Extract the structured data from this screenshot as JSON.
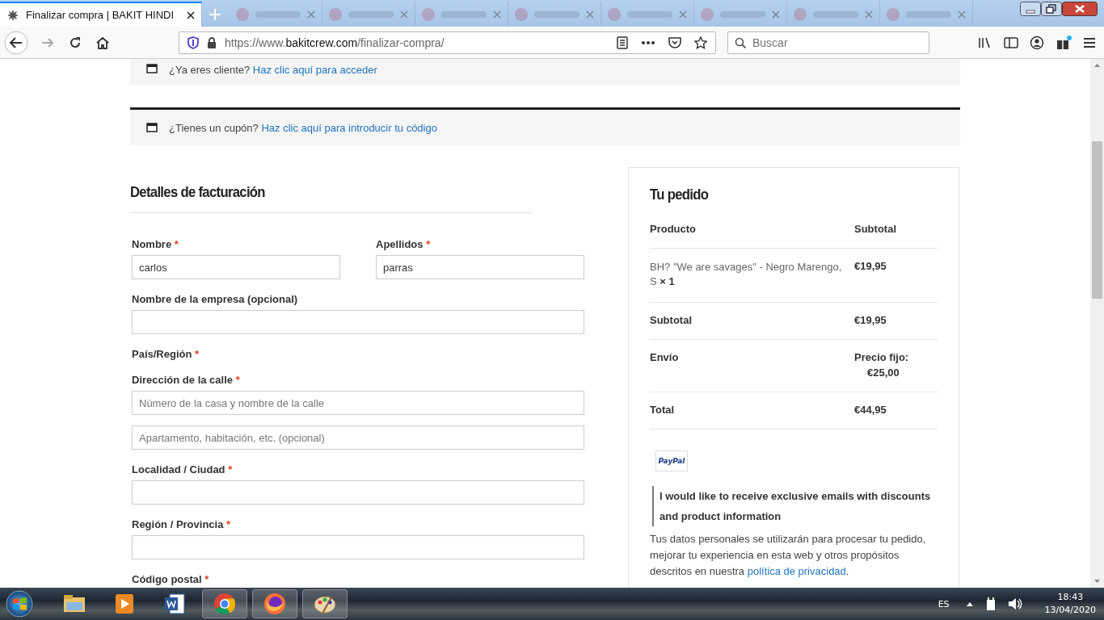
{
  "browser": {
    "tabs": [
      {
        "title": "Finalizar compra | BAKIT HINDI",
        "selected": true
      },
      {
        "selected": false
      },
      {
        "selected": false
      },
      {
        "selected": false
      },
      {
        "selected": false
      },
      {
        "selected": false
      },
      {
        "selected": false
      },
      {
        "selected": false
      },
      {
        "selected": false
      }
    ],
    "url": {
      "host_before": "https://www.",
      "host": "bakitcrew.com",
      "path": "/finalizar-compra/"
    },
    "search": {
      "placeholder": "Buscar"
    }
  },
  "notices": [
    {
      "text": "¿Ya eres cliente?",
      "link": "Haz clic aquí para acceder"
    },
    {
      "text": "¿Tienes un cupón?",
      "link": "Haz clic aquí para introducir tu código"
    }
  ],
  "billing": {
    "title": "Detalles de facturación",
    "rows": [
      [
        {
          "label": "Nombre",
          "required_mark": "*",
          "inputs": [
            {
              "kind": "text",
              "value": "carlos"
            }
          ]
        },
        {
          "label": "Apellidos",
          "required_mark": "*",
          "inputs": [
            {
              "kind": "text",
              "value": "parras"
            }
          ]
        }
      ],
      [
        {
          "label": "Nombre de la empresa (opcional)",
          "inputs": [
            {
              "kind": "text"
            }
          ]
        }
      ],
      [
        {
          "label": "País/Región",
          "required_mark": "*"
        }
      ],
      [
        {
          "label": "Dirección de la calle",
          "required_mark": "*",
          "inputs": [
            {
              "kind": "text",
              "placeholder": "Número de la casa y nombre de la calle"
            },
            {
              "kind": "text",
              "placeholder": "Apartamento, habitación, etc. (opcional)"
            }
          ]
        }
      ],
      [
        {
          "label": "Localidad / Ciudad",
          "required_mark": "*",
          "inputs": [
            {
              "kind": "text"
            }
          ]
        }
      ],
      [
        {
          "label": "Región / Provincia",
          "required_mark": "*",
          "inputs": [
            {
              "kind": "text"
            }
          ]
        }
      ],
      [
        {
          "label": "Código postal",
          "required_mark": "*"
        }
      ]
    ]
  },
  "order": {
    "title": "Tu pedido",
    "columns": [
      "Producto",
      "Subtotal"
    ],
    "items": [
      {
        "name": "BH? \"We are savages\" - Negro Marengo, S",
        "quantity": "× 1",
        "price": "€19,95"
      }
    ],
    "totals": [
      {
        "label": "Subtotal",
        "value": [
          "€19,95"
        ]
      },
      {
        "label": "Envío",
        "value": [
          "Precio fijo:",
          "€25,00"
        ]
      },
      {
        "label": "Total",
        "value": [
          "€44,95"
        ]
      }
    ],
    "payment_logo": "PayPal",
    "consent": "I would like to receive exclusive emails with discounts and product information",
    "privacy": {
      "text": "Tus datos personales se utilizarán para procesar tu pedido, mejorar tu experiencia en esta web y otros propósitos descritos en nuestra",
      "link": "política de privacidad",
      "after": "."
    }
  },
  "taskbar": {
    "apps": [
      {
        "kind": "folder",
        "running": false
      },
      {
        "kind": "media",
        "running": false
      },
      {
        "kind": "word",
        "running": false
      },
      {
        "kind": "chrome",
        "running": true
      },
      {
        "kind": "firefox",
        "running": true
      },
      {
        "kind": "paint",
        "running": true
      }
    ],
    "language": "ES",
    "time": "18:43",
    "date": "13/04/2020"
  }
}
